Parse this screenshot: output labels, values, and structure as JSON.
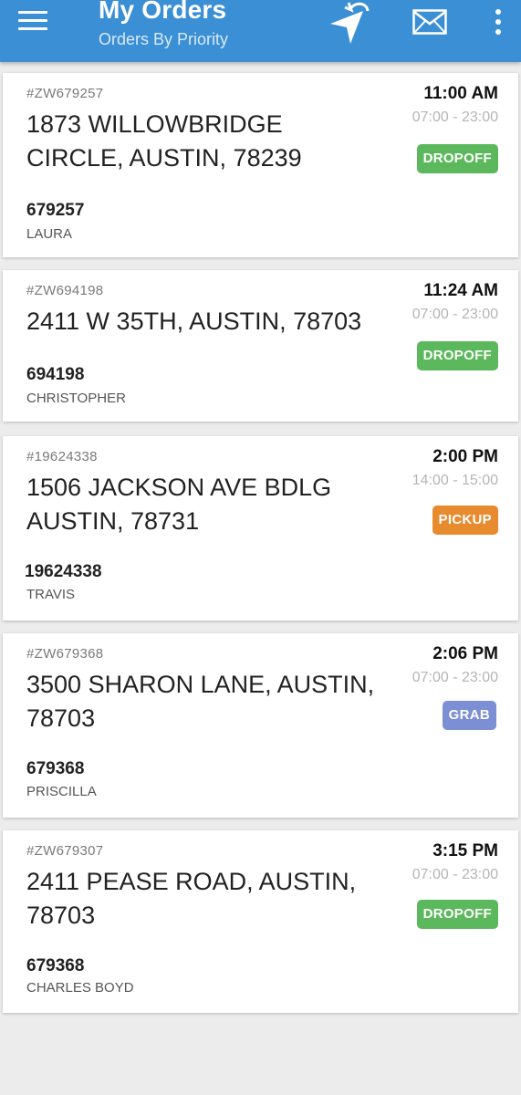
{
  "header": {
    "title": "My Orders",
    "subtitle": "Orders By Priority",
    "icons": [
      "menu-icon",
      "navigate-icon",
      "mail-icon",
      "more-vertical-icon"
    ],
    "color": "#3b8fd4"
  },
  "badge_colors": {
    "DROPOFF": "#5cb85c",
    "PICKUP": "#e88a2e",
    "GRAB": "#7c8ed4"
  },
  "orders": [
    {
      "id": "#ZW679257",
      "address_line1": "1873  WILLOWBRIDGE",
      "address_line2": "CIRCLE, AUSTIN, 78239",
      "time": "11:00 AM",
      "window": "07:00 - 23:00",
      "badge": "DROPOFF",
      "number": "679257",
      "name": "LAURA"
    },
    {
      "id": "#ZW694198",
      "address_line1": "2411 W 35TH, AUSTIN, 78703",
      "address_line2": "",
      "time": "11:24 AM",
      "window": "07:00 - 23:00",
      "badge": "DROPOFF",
      "number": "694198",
      "name": "CHRISTOPHER"
    },
    {
      "id": "#19624338",
      "address_line1": "1506 JACKSON AVE BDLG",
      "address_line2": "AUSTIN, 78731",
      "time": "2:00 PM",
      "window": "14:00 - 15:00",
      "badge": "PICKUP",
      "number": "19624338",
      "name": "TRAVIS"
    },
    {
      "id": "#ZW679368",
      "address_line1": "3500 SHARON LANE, AUSTIN,",
      "address_line2": "78703",
      "time": "2:06 PM",
      "window": "07:00 - 23:00",
      "badge": "GRAB",
      "number": "679368",
      "name": "PRISCILLA"
    },
    {
      "id": "#ZW679307",
      "address_line1": "2411 PEASE ROAD, AUSTIN,",
      "address_line2": "78703",
      "time": "3:15 PM",
      "window": "07:00 - 23:00",
      "badge": "DROPOFF",
      "number": "679368",
      "name": "CHARLES BOYD"
    }
  ]
}
